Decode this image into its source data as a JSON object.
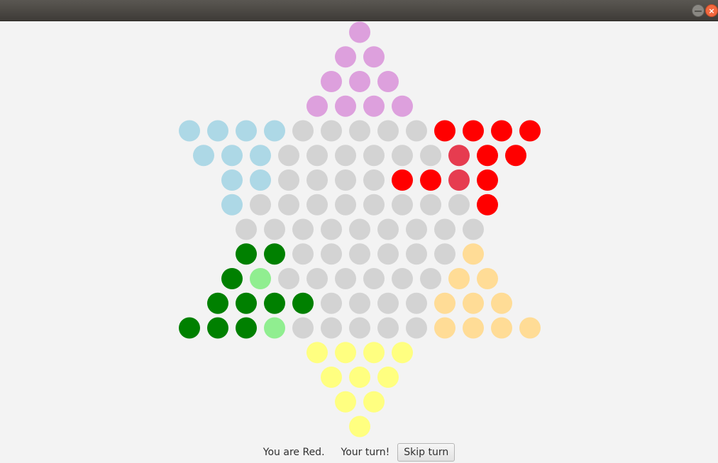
{
  "window": {
    "minimize_glyph": "—",
    "close_glyph": "×"
  },
  "colors": {
    "purple": "#dda0dd",
    "red": "#ff0000",
    "red_highlight": "#e63c50",
    "blue": "#add8e6",
    "gray": "#d3d3d3",
    "orange": "#ffdc96",
    "green": "#008000",
    "green_highlight": "#90ee90",
    "yellow": "#ffff80"
  },
  "board": {
    "rows": [
      "p",
      "pp",
      "ppp",
      "pppp",
      "bbbbgggggRRRR",
      "bbbggggggrRR",
      "bbggggRRrR",
      "bggggggggR",
      "ggggggggg",
      "GGggggggo",
      "GHggggggoo",
      "GGGGggggooo",
      "GGGHgggggoooo",
      "yyyy",
      "yyy",
      "yy",
      "y"
    ]
  },
  "status": {
    "player_text": "You are Red.",
    "turn_text": "Your turn!",
    "skip_label": "Skip turn"
  }
}
